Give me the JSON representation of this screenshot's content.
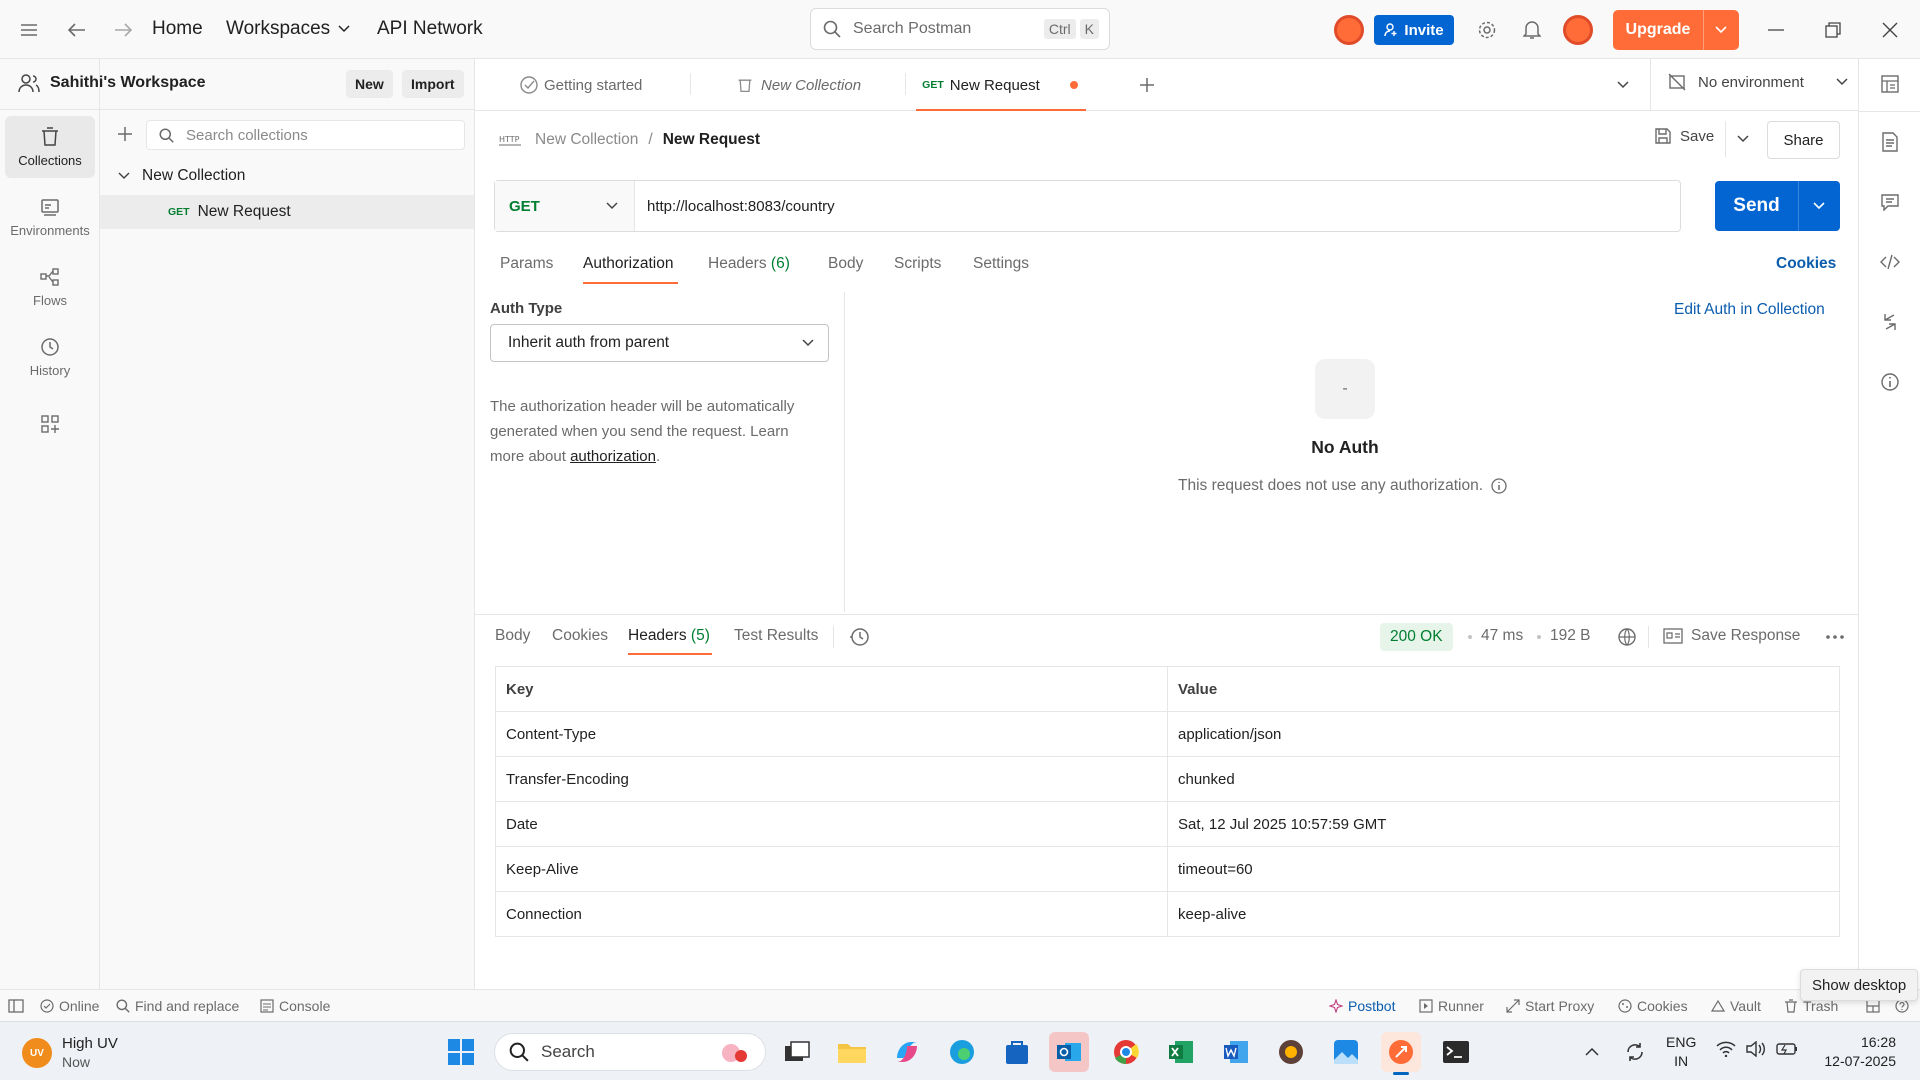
{
  "topbar": {
    "home": "Home",
    "workspaces": "Workspaces",
    "api_network": "API Network",
    "search_placeholder": "Search Postman",
    "shortcut_ctrl": "Ctrl",
    "shortcut_k": "K",
    "invite": "Invite",
    "upgrade": "Upgrade"
  },
  "rail": {
    "items": [
      {
        "label": "Collections",
        "icon": "collections-icon"
      },
      {
        "label": "Environments",
        "icon": "environments-icon"
      },
      {
        "label": "Flows",
        "icon": "flows-icon"
      },
      {
        "label": "History",
        "icon": "history-icon"
      }
    ]
  },
  "sidebar": {
    "workspace_name": "Sahithi's Workspace",
    "new_label": "New",
    "import_label": "Import",
    "search_placeholder": "Search collections",
    "collection_name": "New Collection",
    "request_method": "GET",
    "request_name": "New Request"
  },
  "tabs": {
    "items": [
      "Getting started",
      "New Collection",
      "New Request"
    ],
    "active_method": "GET",
    "environment": "No environment"
  },
  "request": {
    "breadcrumb_collection": "New Collection",
    "breadcrumb_sep": "/",
    "breadcrumb_request": "New Request",
    "save": "Save",
    "share": "Share",
    "method": "GET",
    "url": "http://localhost:8083/country",
    "send": "Send",
    "subtabs": {
      "params": "Params",
      "authorization": "Authorization",
      "headers": "Headers",
      "headers_count": "(6)",
      "body": "Body",
      "scripts": "Scripts",
      "settings": "Settings"
    },
    "cookies": "Cookies"
  },
  "auth": {
    "type_label": "Auth Type",
    "type_value": "Inherit auth from parent",
    "description_1": "The authorization header will be automatically",
    "description_2": "generated when you send the request. Learn",
    "description_3": "more about",
    "description_link": "authorization",
    "description_end": ".",
    "edit_link": "Edit Auth in Collection",
    "no_auth_symbol": "-",
    "no_auth_title": "No Auth",
    "no_auth_desc": "This request does not use any authorization."
  },
  "response": {
    "tabs": {
      "body": "Body",
      "cookies": "Cookies",
      "headers": "Headers",
      "headers_count": "(5)",
      "test_results": "Test Results"
    },
    "status": "200 OK",
    "time": "47 ms",
    "size": "192 B",
    "save_response": "Save Response",
    "columns": [
      "Key",
      "Value"
    ],
    "rows": [
      {
        "key": "Content-Type",
        "value": "application/json"
      },
      {
        "key": "Transfer-Encoding",
        "value": "chunked"
      },
      {
        "key": "Date",
        "value": "Sat, 12 Jul 2025 10:57:59 GMT"
      },
      {
        "key": "Keep-Alive",
        "value": "timeout=60"
      },
      {
        "key": "Connection",
        "value": "keep-alive"
      }
    ]
  },
  "statusbar": {
    "online": "Online",
    "find_replace": "Find and replace",
    "console": "Console",
    "postbot": "Postbot",
    "runner": "Runner",
    "start_proxy": "Start Proxy",
    "cookies": "Cookies",
    "vault": "Vault",
    "trash": "Trash",
    "tooltip": "Show desktop"
  },
  "taskbar": {
    "weather_title": "High UV",
    "weather_sub": "Now",
    "weather_badge": "UV",
    "search": "Search",
    "lang_1": "ENG",
    "lang_2": "IN",
    "time": "16:28",
    "date": "12-07-2025"
  },
  "colors": {
    "accent": "#ff6c37",
    "send_blue": "#0265d2",
    "link_blue": "#0b5cad",
    "status_green": "#007f31",
    "get_green": "#007f31"
  }
}
